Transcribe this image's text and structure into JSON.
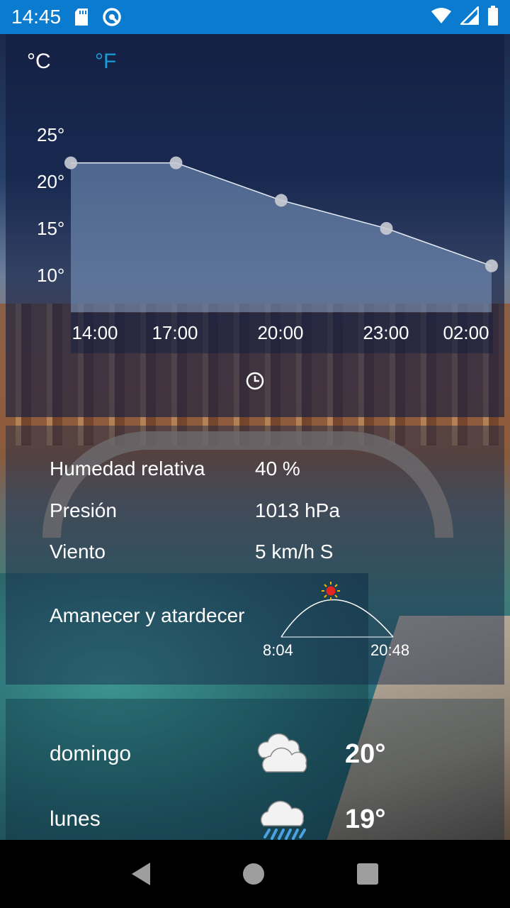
{
  "status": {
    "time": "14:45",
    "icons": [
      "sd-card-icon",
      "vpn-icon",
      "wifi-icon",
      "signal-icon",
      "battery-icon"
    ]
  },
  "units": {
    "celsius": "°C",
    "fahrenheit": "°F",
    "active": "celsius",
    "active_color": "#ffffff",
    "inactive_color": "#1b9bd8"
  },
  "chart_data": {
    "type": "area",
    "x": [
      "14:00",
      "17:00",
      "20:00",
      "23:00",
      "02:00"
    ],
    "values": [
      22,
      22,
      18,
      15,
      11
    ],
    "y_ticks": [
      "25°",
      "20°",
      "15°",
      "10°"
    ],
    "ylim": [
      10,
      25
    ],
    "fill_color": "#7f9cc4",
    "line_color": "#e6ecf5",
    "grid": false
  },
  "details": {
    "humidity_label": "Humedad relativa",
    "humidity_value": "40 %",
    "pressure_label": "Presión",
    "pressure_value": "1013 hPa",
    "wind_label": "Viento",
    "wind_value": "5 km/h S",
    "sun_label": "Amanecer y atardecer",
    "sunrise": "8:04",
    "sunset": "20:48"
  },
  "forecast": [
    {
      "day": "domingo",
      "temp": "20°",
      "icon": "cloudy-icon"
    },
    {
      "day": "lunes",
      "temp": "19°",
      "icon": "rain-cloud-icon"
    }
  ]
}
